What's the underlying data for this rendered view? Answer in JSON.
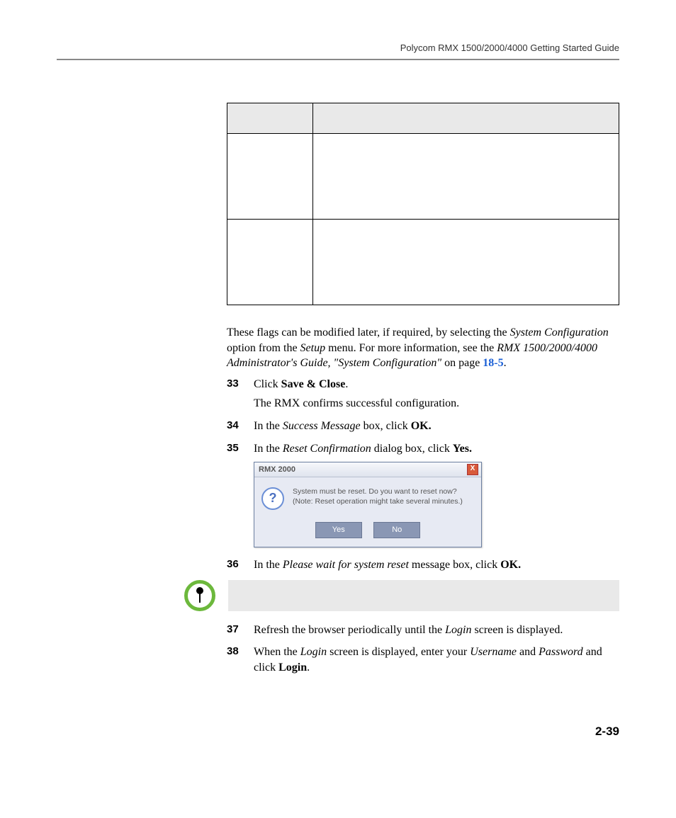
{
  "header": {
    "guide_title": "Polycom RMX 1500/2000/4000 Getting Started Guide"
  },
  "para1": {
    "t1": "These flags can be modified later, if required, by selecting the ",
    "i1": "System Configuration",
    "t2": " option from the ",
    "i2": "Setup",
    "t3": " menu. For more information, see the ",
    "i3": "RMX 1500/2000/4000 Administrator's Guide, \"System Configuration\"",
    "t4": " on page ",
    "link": "18-5",
    "t5": "."
  },
  "steps": {
    "s33": {
      "num": "33",
      "pre": "Click ",
      "bold": "Save & Close",
      "post": ".",
      "sub": "The RMX confirms successful configuration."
    },
    "s34": {
      "num": "34",
      "pre": "In the ",
      "ital": "Success Message",
      "mid": " box, click ",
      "bold": "OK."
    },
    "s35": {
      "num": "35",
      "pre": "In the ",
      "ital": "Reset Confirmation",
      "mid": " dialog box, click ",
      "bold": "Yes."
    },
    "s36": {
      "num": "36",
      "pre": "In the ",
      "ital": "Please wait for system reset",
      "mid": " message box, click ",
      "bold": "OK."
    },
    "s37": {
      "num": "37",
      "pre": "Refresh the browser periodically until the ",
      "ital": "Login",
      "post": " screen is displayed."
    },
    "s38": {
      "num": "38",
      "pre": "When the ",
      "ital1": "Login",
      "mid1": " screen is displayed, enter your ",
      "ital2": "Username",
      "mid2": " and ",
      "ital3": "Password",
      "mid3": " and click ",
      "bold": "Login",
      "post": "."
    }
  },
  "dialog": {
    "title": "RMX 2000",
    "msg1": "System must be reset. Do you want to reset now?",
    "msg2": "(Note: Reset operation might take several minutes.)",
    "yes": "Yes",
    "no": "No",
    "close": "X",
    "q": "?"
  },
  "page_number": "2-39"
}
